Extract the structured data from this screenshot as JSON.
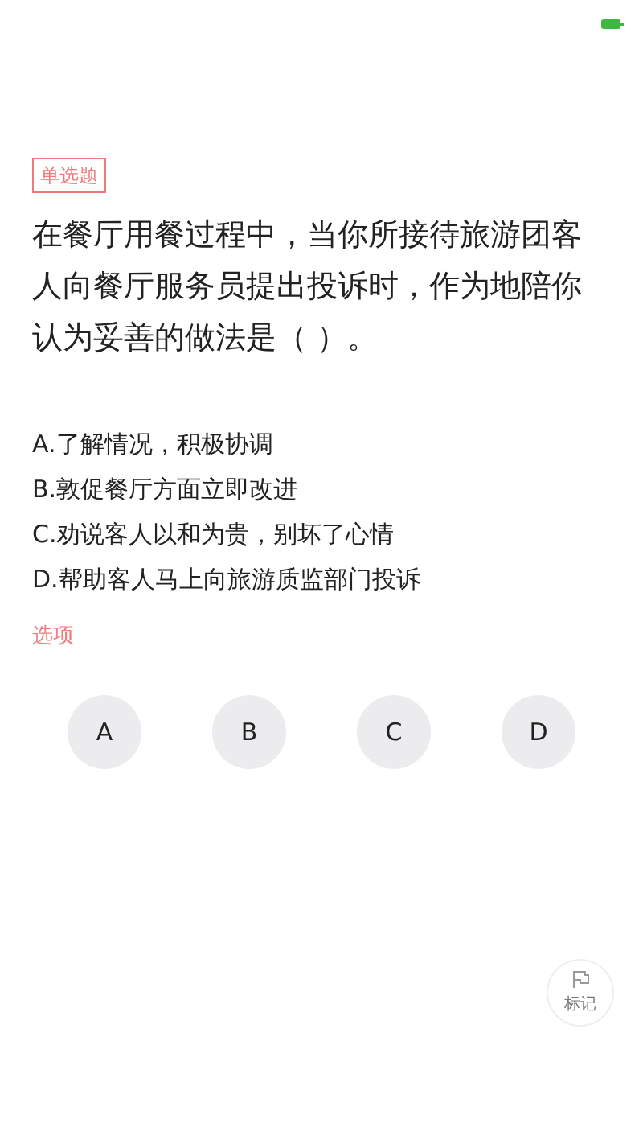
{
  "question": {
    "type_tag": "单选题",
    "text": "在餐厅用餐过程中，当你所接待旅游团客人向餐厅服务员提出投诉时，作为地陪你认为妥善的做法是（ ）。"
  },
  "options": [
    {
      "text": "A.了解情况，积极协调"
    },
    {
      "text": "B.敦促餐厅方面立即改进"
    },
    {
      "text": "C.劝说客人以和为贵，别坏了心情"
    },
    {
      "text": "D.帮助客人马上向旅游质监部门投诉"
    }
  ],
  "answer_label": "选项",
  "answer_buttons": [
    {
      "label": "A",
      "selected": false
    },
    {
      "label": "B",
      "selected": false
    },
    {
      "label": "C",
      "selected": false
    },
    {
      "label": "D",
      "selected": false
    }
  ],
  "mark_button": {
    "label": "标记"
  }
}
